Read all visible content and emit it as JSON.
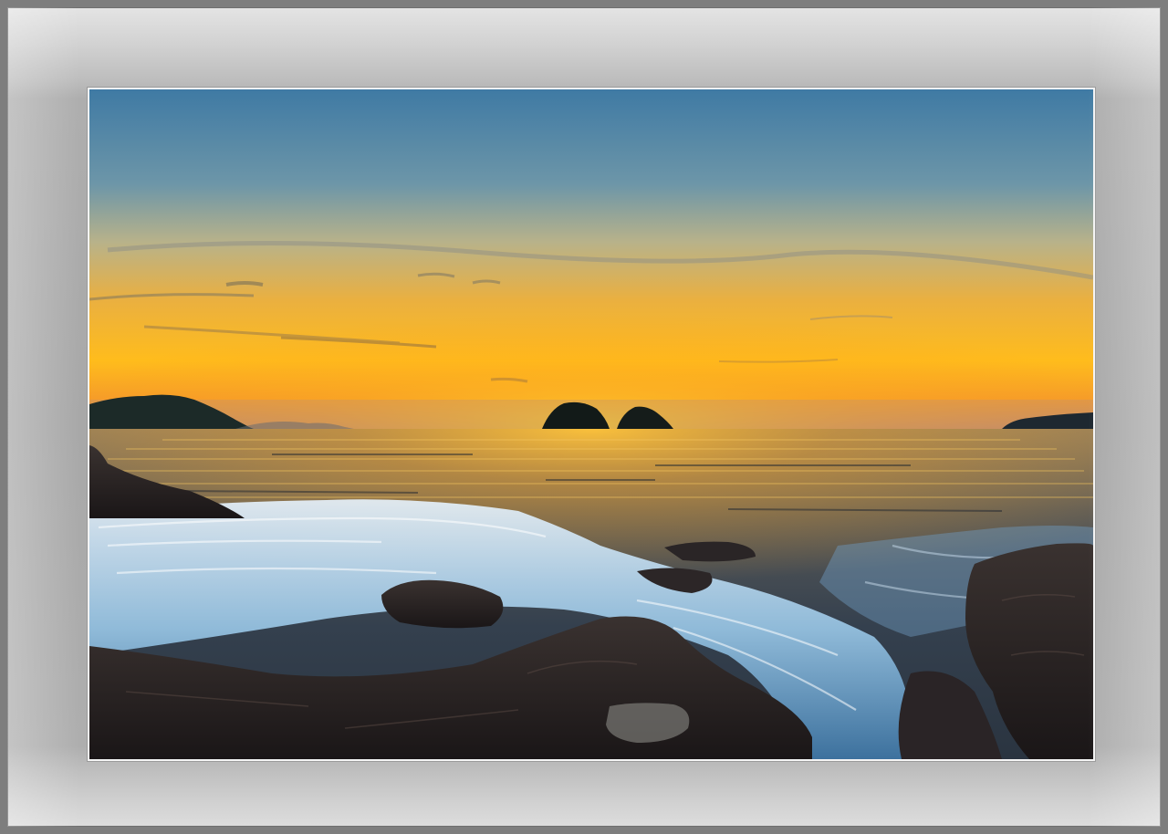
{
  "image": {
    "subject": "",
    "palette": {
      "sky_top": "#3f7fa8",
      "sky_mid": "#a8b4a0",
      "horizon_glow": "#ffb21a",
      "horizon_orange": "#f08a1c",
      "sea_dark": "#2e3540",
      "sea_reflection": "#f2b33a",
      "wave_white": "#dff0ff",
      "rock_dark": "#231d1e",
      "mat_light": "#e0e0e0",
      "mat_dark": "#a8a8a8"
    },
    "elements": [
      "island-left-icon",
      "twin-rock-islets-icon",
      "island-right-icon",
      "crashing-wave-icon",
      "foreground-rocks-icon"
    ]
  }
}
